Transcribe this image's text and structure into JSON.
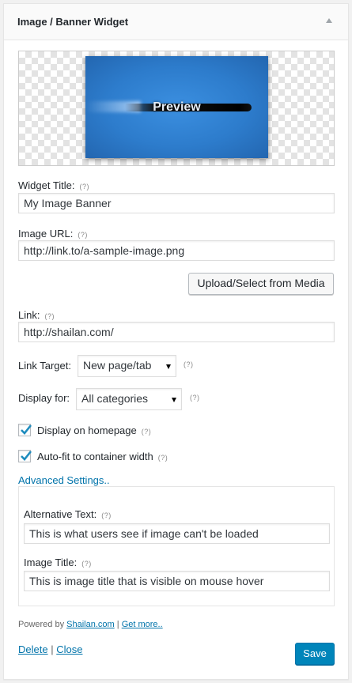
{
  "widget": {
    "title": "Image / Banner Widget"
  },
  "preview": {
    "label": "Preview"
  },
  "help_mark": "(?)",
  "fields": {
    "widget_title": {
      "label": "Widget Title:",
      "value": "My Image Banner"
    },
    "image_url": {
      "label": "Image URL:",
      "value": "http://link.to/a-sample-image.png"
    },
    "upload_button": "Upload/Select from Media",
    "link": {
      "label": "Link:",
      "value": "http://shailan.com/"
    },
    "link_target": {
      "label": "Link Target:",
      "selected": "New page/tab"
    },
    "display_for": {
      "label": "Display for:",
      "selected": "All categories"
    },
    "display_on_homepage": {
      "label": "Display on homepage",
      "checked": true
    },
    "auto_fit": {
      "label": "Auto-fit to container width",
      "checked": true
    }
  },
  "advanced": {
    "toggle_label": "Advanced Settings..",
    "alt_text": {
      "label": "Alternative Text:",
      "value": "This is what users see if image can't be loaded"
    },
    "image_title": {
      "label": "Image Title:",
      "value": "This is image title that is visible on mouse hover"
    }
  },
  "footer": {
    "powered_by": "Powered by",
    "shailan_link": "Shailan.com",
    "separator": "|",
    "get_more_link": "Get more.."
  },
  "actions": {
    "delete": "Delete",
    "separator": "|",
    "close": "Close",
    "save": "Save"
  },
  "colors": {
    "link": "#0073aa",
    "primary_button": "#0085ba",
    "checkmark": "#1e8cbe"
  }
}
